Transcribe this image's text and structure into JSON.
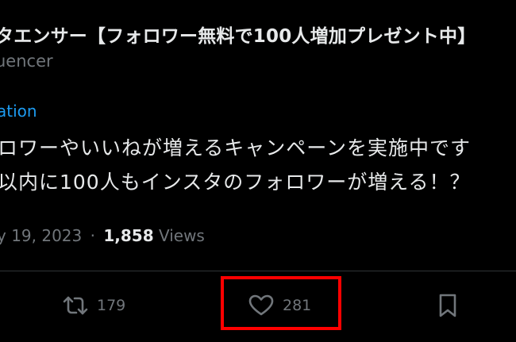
{
  "tweet": {
    "display_name": "タエンサー【フォロワー無料で100人増加プレゼント中】",
    "handle": "uencer",
    "link_text": "ation",
    "body_line1": "ロワーやいいねが増えるキャンペーンを実施中です",
    "body_line2": "以内に100人もインスタのフォロワーが増える！？",
    "date": "y 19, 2023",
    "separator": "·",
    "views_count": "1,858",
    "views_label": "Views"
  },
  "actions": {
    "retweet_count": "179",
    "like_count": "281",
    "retweet_icon": "retweet-icon",
    "like_icon": "heart-icon",
    "bookmark_icon": "bookmark-icon"
  },
  "colors": {
    "background": "#000000",
    "text_primary": "#e7e9ea",
    "text_secondary": "#71767b",
    "link": "#1d9bf0",
    "highlight": "#ff0000"
  }
}
